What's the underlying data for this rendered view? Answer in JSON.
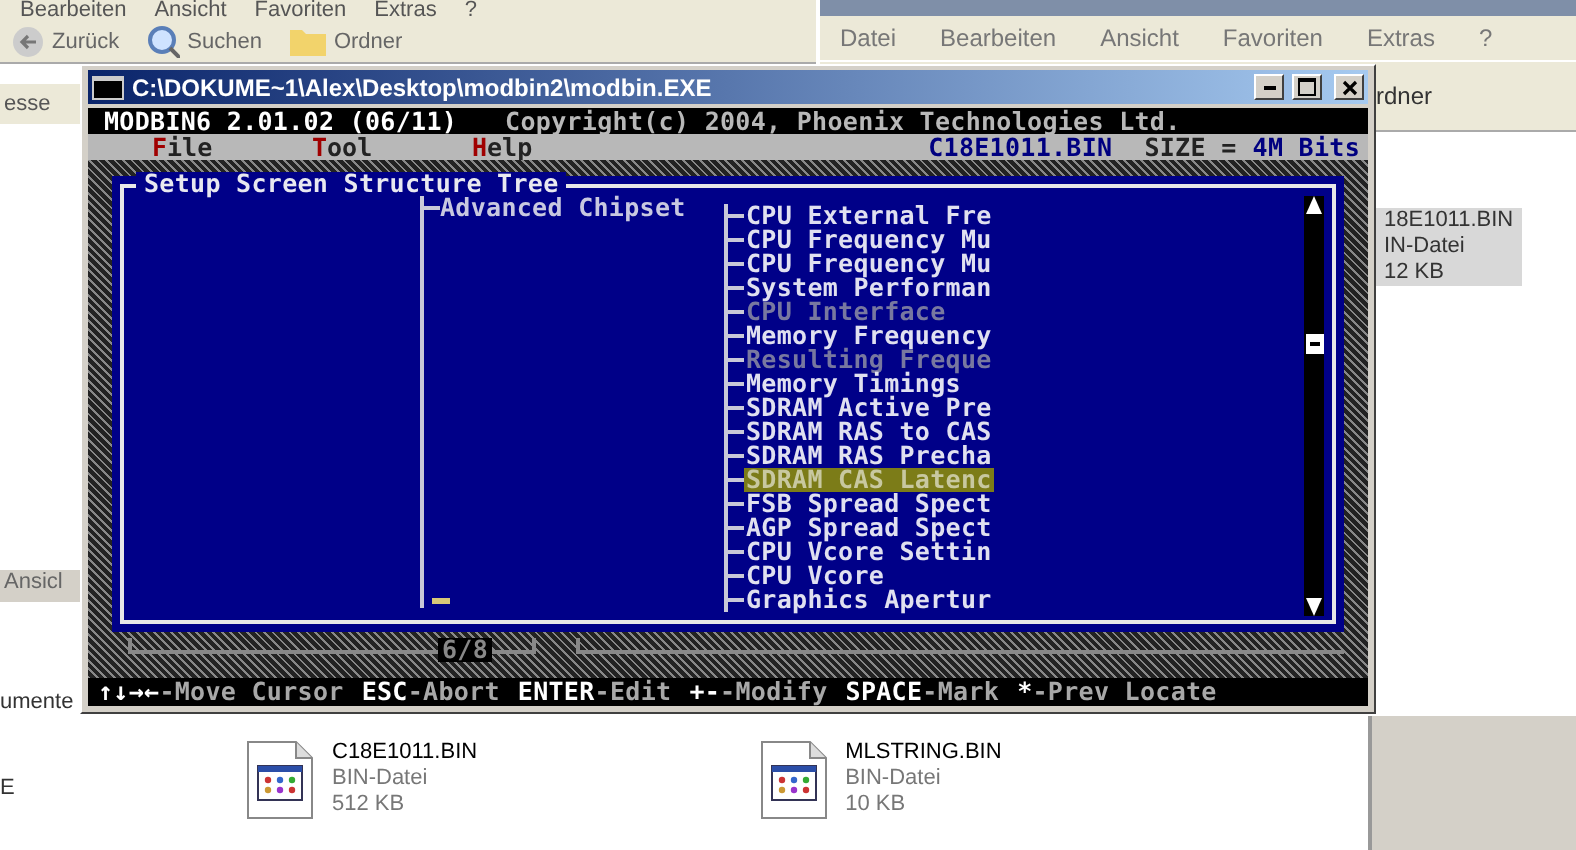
{
  "explorer_back": {
    "menu": [
      "Bearbeiten",
      "Ansicht",
      "Favoriten",
      "Extras",
      "?"
    ],
    "toolbar": [
      {
        "label": "Zurück"
      },
      {
        "label": "Suchen"
      },
      {
        "label": "Ordner"
      }
    ],
    "address_label": "esse",
    "pane_label": "Ansicl",
    "side_text": [
      "umente",
      "E"
    ],
    "files": [
      {
        "name": "C18E1011.BIN",
        "type": "BIN-Datei",
        "size": "512 KB"
      },
      {
        "name": "MLSTRING.BIN",
        "type": "BIN-Datei",
        "size": "10 KB"
      }
    ]
  },
  "explorer_front": {
    "menu": [
      "Datei",
      "Bearbeiten",
      "Ansicht",
      "Favoriten",
      "Extras",
      "?"
    ],
    "toolbar_label": "rdner",
    "file": {
      "name": "18E1011.BIN",
      "type": "IN-Datei",
      "size": "12 KB",
      "selected": true
    }
  },
  "console": {
    "title": "C:\\DOKUME~1\\Alex\\Desktop\\modbin2\\modbin.EXE",
    "program": "MODBIN6 2.01.02 (06/11)",
    "copyright": "Copyright(c) 2004, Phoenix Technologies Ltd.",
    "menu": [
      "File",
      "Tool",
      "Help"
    ],
    "file_name": "C18E1011.BIN",
    "size_label": "SIZE =",
    "size_value": "4M Bits",
    "panel_title": "Setup Screen Structure Tree",
    "parent": "Advanced Chipset",
    "items": [
      {
        "label": "CPU External Fre",
        "disabled": false,
        "selected": false
      },
      {
        "label": "CPU Frequency Mu",
        "disabled": false,
        "selected": false
      },
      {
        "label": "CPU Frequency Mu",
        "disabled": false,
        "selected": false
      },
      {
        "label": "System Performan",
        "disabled": false,
        "selected": false
      },
      {
        "label": "CPU Interface",
        "disabled": true,
        "selected": false
      },
      {
        "label": "Memory Frequency",
        "disabled": false,
        "selected": false
      },
      {
        "label": "Resulting Freque",
        "disabled": true,
        "selected": false
      },
      {
        "label": "Memory Timings",
        "disabled": false,
        "selected": false
      },
      {
        "label": "SDRAM Active Pre",
        "disabled": false,
        "selected": false
      },
      {
        "label": "SDRAM RAS to CAS",
        "disabled": false,
        "selected": false
      },
      {
        "label": "SDRAM RAS Precha",
        "disabled": false,
        "selected": false
      },
      {
        "label": "SDRAM CAS Latenc",
        "disabled": false,
        "selected": true
      },
      {
        "label": "FSB Spread Spect",
        "disabled": false,
        "selected": false
      },
      {
        "label": "AGP Spread Spect",
        "disabled": false,
        "selected": false
      },
      {
        "label": "CPU Vcore Settin",
        "disabled": false,
        "selected": false
      },
      {
        "label": "CPU Vcore",
        "disabled": false,
        "selected": false
      },
      {
        "label": "Graphics Apertur",
        "disabled": false,
        "selected": false
      }
    ],
    "page": "6/8",
    "hints": [
      {
        "key": "↑↓→←",
        "action": "-Move Cursor"
      },
      {
        "key": "ESC",
        "action": "-Abort"
      },
      {
        "key": "ENTER",
        "action": "-Edit"
      },
      {
        "key": "+-",
        "action": "-Modify"
      },
      {
        "key": "SPACE",
        "action": "-Mark"
      },
      {
        "key": "*",
        "action": "-Prev Locate"
      }
    ]
  }
}
